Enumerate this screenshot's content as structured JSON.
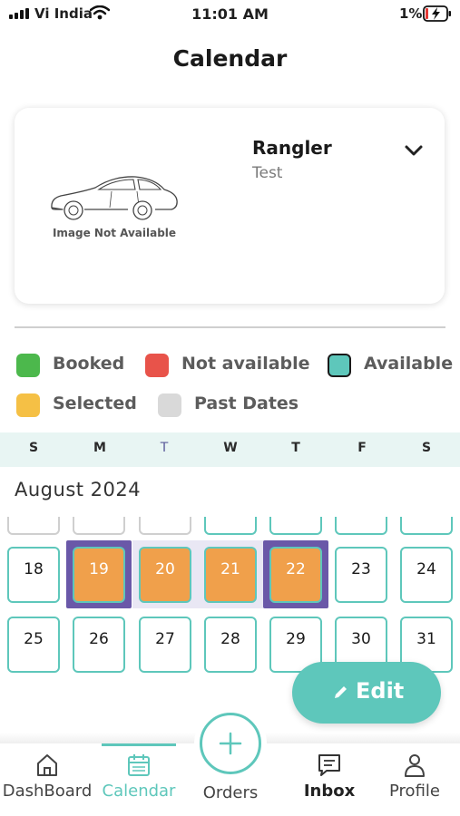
{
  "status_bar": {
    "carrier": "Vi India",
    "time": "11:01 AM",
    "battery": "1%"
  },
  "header": {
    "title": "Calendar"
  },
  "vehicle": {
    "name": "Rangler",
    "subtitle": "Test",
    "image_placeholder": "Image Not Available"
  },
  "legend": [
    {
      "label": "Booked",
      "color": "#4cb84c"
    },
    {
      "label": "Not available",
      "color": "#e8534a"
    },
    {
      "label": "Available",
      "color": "#5ec7bb"
    },
    {
      "label": "Selected",
      "color": "#f5c045"
    },
    {
      "label": "Past Dates",
      "color": "#d9d9d9"
    }
  ],
  "weekdays": [
    "S",
    "M",
    "T",
    "W",
    "T",
    "F",
    "S"
  ],
  "month_title": "August 2024",
  "calendar": {
    "row1": [
      "18",
      "19",
      "20",
      "21",
      "22",
      "23",
      "24"
    ],
    "row2": [
      "25",
      "26",
      "27",
      "28",
      "29",
      "30",
      "31"
    ],
    "selected_days": [
      "19",
      "20",
      "21",
      "22"
    ]
  },
  "edit_button": {
    "label": "Edit"
  },
  "nav": {
    "dashboard": "DashBoard",
    "calendar": "Calendar",
    "orders": "Orders",
    "inbox": "Inbox",
    "profile": "Profile",
    "active": "Calendar"
  },
  "colors": {
    "accent": "#5ec7bb",
    "selected_fill": "#f0a04b",
    "selection_frame": "#6a58a8"
  }
}
